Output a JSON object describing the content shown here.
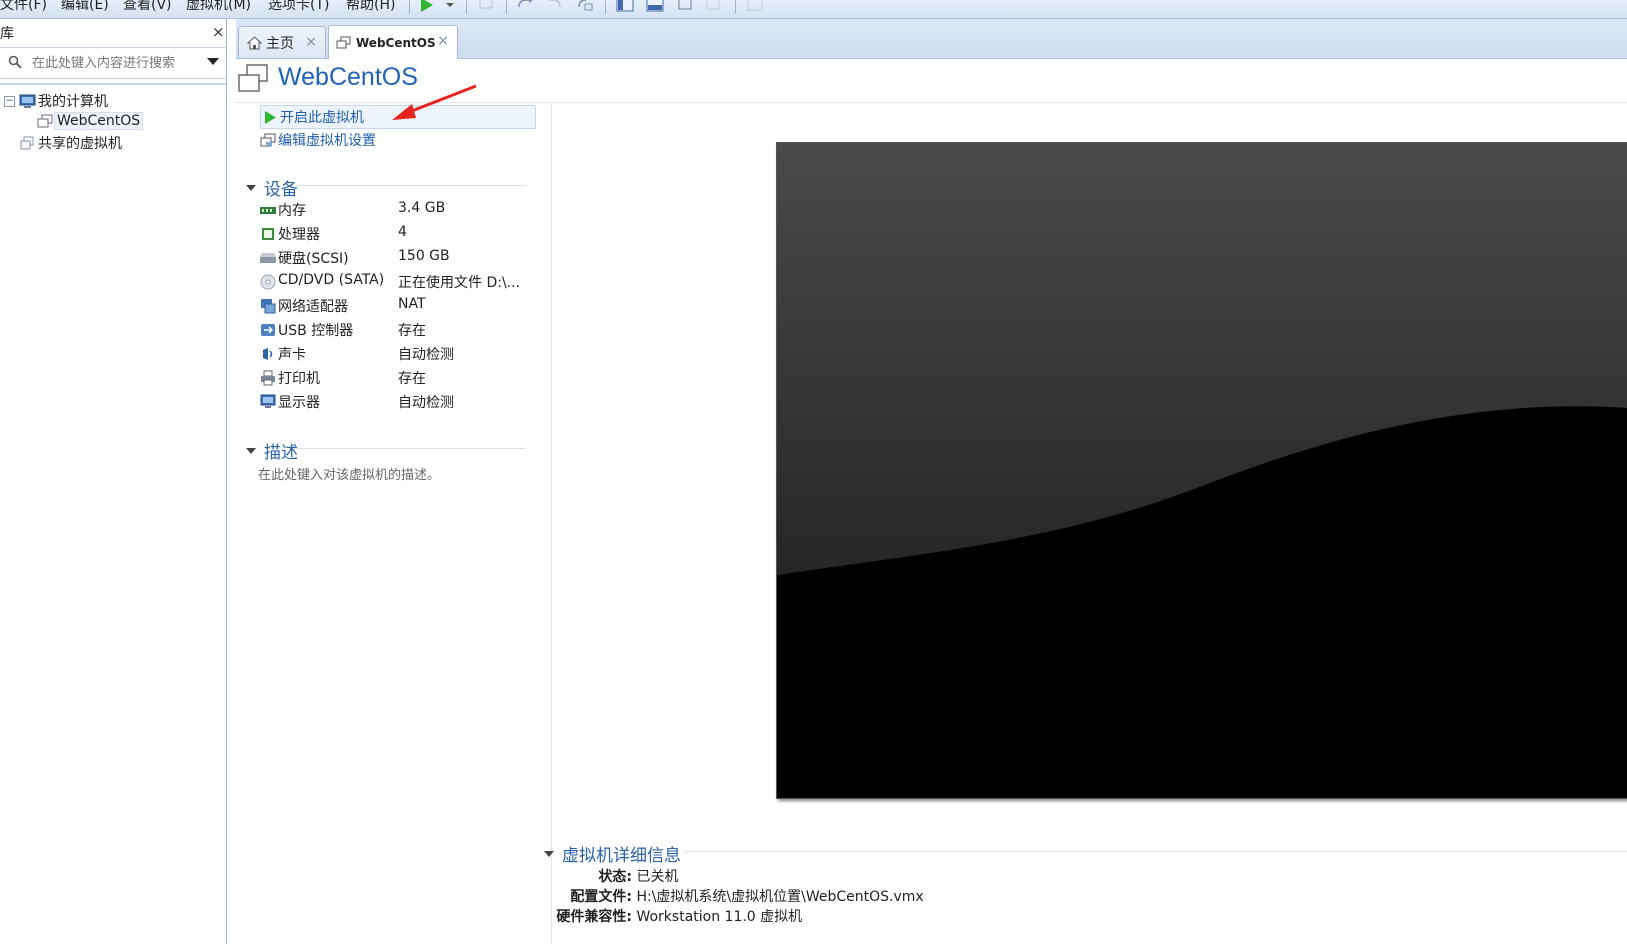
{
  "menubar": {
    "items": [
      "文件(F)",
      "编辑(E)",
      "查看(V)",
      "虚拟机(M)",
      "选项卡(T)",
      "帮助(H)"
    ]
  },
  "library": {
    "title": "库",
    "close_glyph": "×",
    "search_placeholder": "在此处键入内容进行搜索",
    "tree": {
      "my_computer": "我的计算机",
      "vm": "WebCentOS",
      "shared": "共享的虚拟机"
    }
  },
  "tabs": [
    {
      "label": "主页",
      "icon": "home-icon",
      "close": "×"
    },
    {
      "label": "WebCentOS",
      "icon": "vm-icon",
      "close": "×"
    }
  ],
  "vm": {
    "title": "WebCentOS",
    "actions": {
      "power_on": "开启此虚拟机",
      "edit_settings": "编辑虚拟机设置"
    },
    "devices_header": "设备",
    "devices": [
      {
        "name": "内存",
        "value": "3.4 GB",
        "icon": "memory-icon"
      },
      {
        "name": "处理器",
        "value": "4",
        "icon": "cpu-icon"
      },
      {
        "name": "硬盘(SCSI)",
        "value": "150 GB",
        "icon": "harddisk-icon"
      },
      {
        "name": "CD/DVD (SATA)",
        "value": "正在使用文件 D:\\...",
        "icon": "cdrom-icon"
      },
      {
        "name": "网络适配器",
        "value": "NAT",
        "icon": "network-icon"
      },
      {
        "name": "USB 控制器",
        "value": "存在",
        "icon": "usb-icon"
      },
      {
        "name": "声卡",
        "value": "自动检测",
        "icon": "sound-icon"
      },
      {
        "name": "打印机",
        "value": "存在",
        "icon": "printer-icon"
      },
      {
        "name": "显示器",
        "value": "自动检测",
        "icon": "monitor-icon"
      }
    ],
    "description_header": "描述",
    "description_placeholder": "在此处键入对该虚拟机的描述。",
    "details_header": "虚拟机详细信息",
    "details": [
      {
        "key": "状态:",
        "value": "已关机"
      },
      {
        "key": "配置文件:",
        "value": "H:\\虚拟机系统\\虚拟机位置\\WebCentOS.vmx"
      },
      {
        "key": "硬件兼容性:",
        "value": "Workstation 11.0 虚拟机"
      }
    ]
  },
  "colors": {
    "accent": "#1e63b6",
    "link": "#1f5fae",
    "annotation_arrow": "#e8231f"
  }
}
